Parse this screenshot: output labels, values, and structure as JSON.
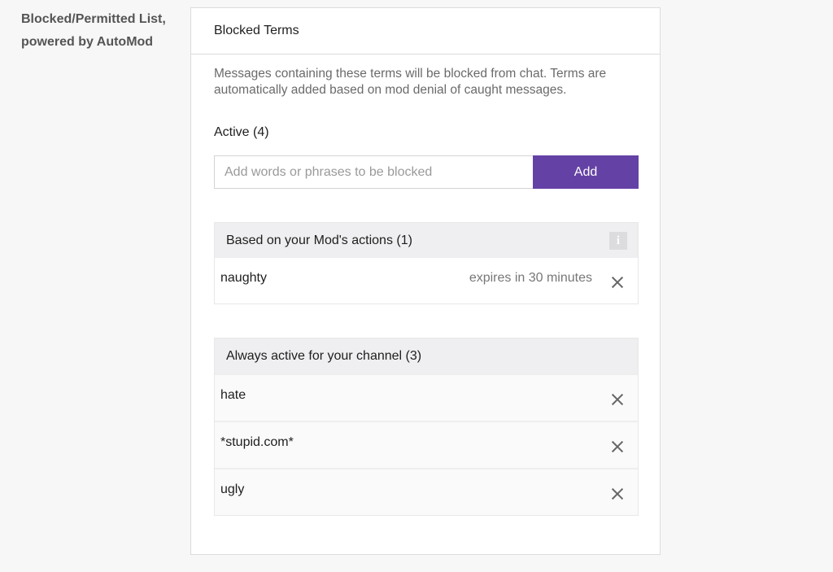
{
  "settings_label": "Blocked/Permitted List, powered by AutoMod",
  "panel": {
    "title": "Blocked Terms",
    "description": "Messages containing these terms will be blocked from chat. Terms are automatically added based on mod denial of caught messages.",
    "active_label": "Active (4)",
    "input_placeholder": "Add words or phrases to be blocked",
    "input_value": "",
    "add_button_label": "Add",
    "accent_color": "#6441a5"
  },
  "mod_group": {
    "header": "Based on your Mod's actions (1)",
    "info_icon": "info-icon",
    "terms": [
      {
        "term": "naughty",
        "expires": "expires in 30 minutes"
      }
    ]
  },
  "channel_group": {
    "header": "Always active for your channel (3)",
    "terms": [
      {
        "term": "hate"
      },
      {
        "term": "*stupid.com*"
      },
      {
        "term": "ugly"
      }
    ]
  }
}
